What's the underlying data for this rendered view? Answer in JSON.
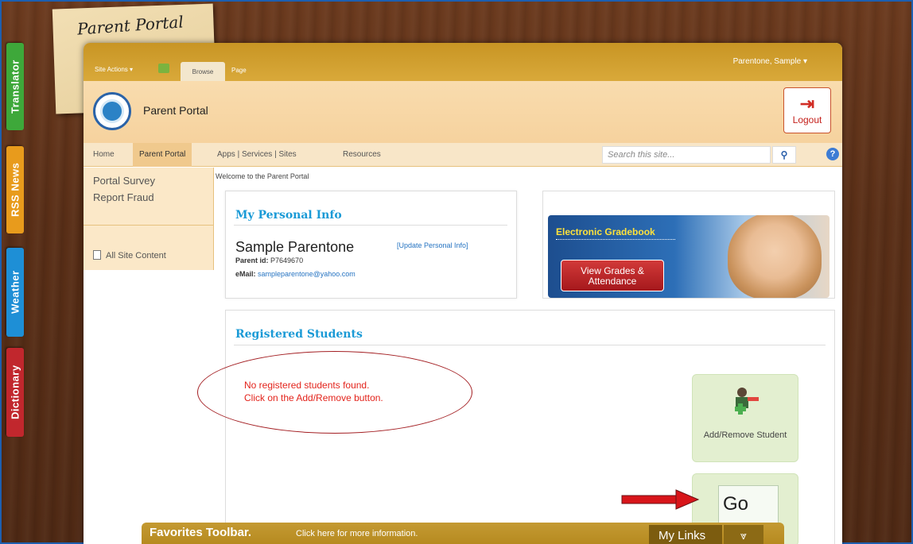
{
  "side_tabs": {
    "translator": "Translator",
    "rss": "RSS News",
    "weather": "Weather",
    "dictionary": "Dictionary"
  },
  "note_title": "Parent Portal",
  "ribbon": {
    "site_actions": "Site Actions ▾",
    "browse": "Browse",
    "page": "Page",
    "user": "Parentone, Sample ▾"
  },
  "header": {
    "site_title": "Parent Portal",
    "logout": "Logout"
  },
  "nav": {
    "items": [
      "Home",
      "Parent Portal",
      "Apps | Services | Sites",
      "Resources"
    ],
    "search_placeholder": "Search this site...",
    "help": "?"
  },
  "left_nav": {
    "items": [
      "Portal Survey",
      "Report Fraud"
    ],
    "all_site_content": "All Site Content"
  },
  "welcome": "Welcome to the Parent Portal",
  "personal_info": {
    "title": "My Personal Info",
    "name": "Sample Parentone",
    "update_link": "[Update Personal Info]",
    "parent_id_label": "Parent id:",
    "parent_id": "P7649670",
    "email_label": "eMail:",
    "email": "sampleparentone@yahoo.com"
  },
  "banner": {
    "title": "Electronic Gradebook",
    "button": "View Grades & Attendance"
  },
  "students": {
    "title": "Registered Students",
    "message_line1": "No registered students found.",
    "message_line2": "Click on the Add/Remove button.",
    "add_remove_label": "Add/Remove Student",
    "go_label": "Go"
  },
  "favorites_toolbar": {
    "title": "Favorites Toolbar.",
    "info": "Click here for more information.",
    "my_links": "My Links"
  },
  "colors": {
    "ribbon": "#c89524",
    "header": "#f9dcae",
    "accent_blue": "#1a9ad6",
    "error_red": "#e3231b"
  }
}
